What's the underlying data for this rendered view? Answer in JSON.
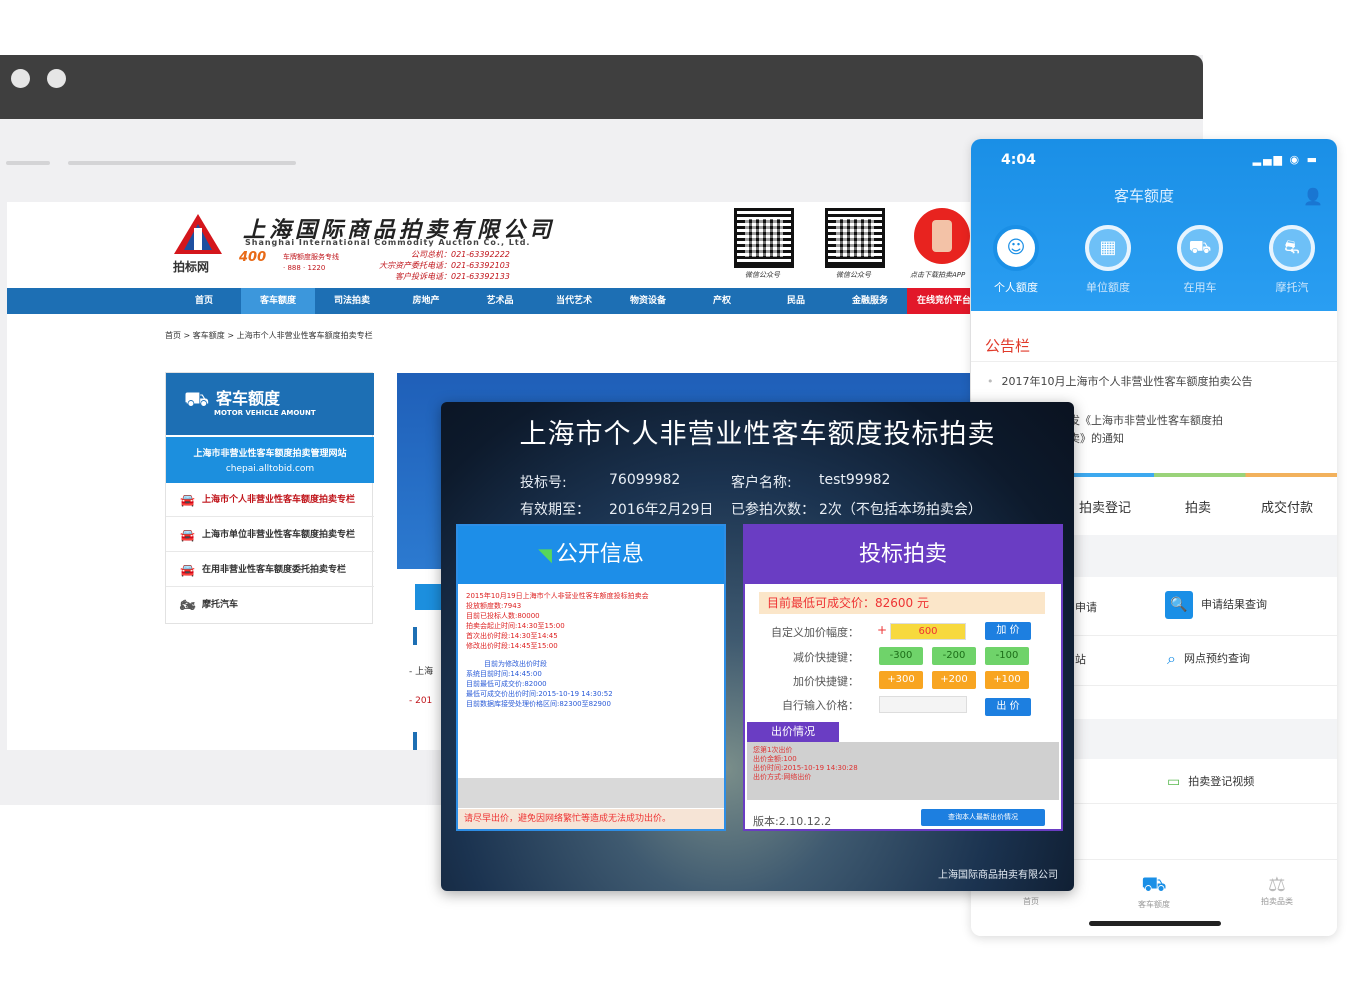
{
  "website": {
    "logo_small": "拍标网",
    "brand_cn": "上海国际商品拍卖有限公司",
    "brand_en": "Shanghai International Commodity Auction Co., Ltd.",
    "badge": "400",
    "hotline": "车牌额度服务专线",
    "hotline_num": "· 888 · 1220",
    "phones": [
      "公司总机：021-63392222",
      "大宗资产委托电话：021-63392103",
      "客户投诉电话：021-63392133"
    ],
    "qr_captions": [
      "微信公众号",
      "微信公众号"
    ],
    "app_caption": "点击下载拍卖APP",
    "nav": [
      {
        "label": "首页",
        "state": "normal"
      },
      {
        "label": "客车额度",
        "state": "active"
      },
      {
        "label": "司法拍卖",
        "state": "normal"
      },
      {
        "label": "房地产",
        "state": "normal"
      },
      {
        "label": "艺术品",
        "state": "normal"
      },
      {
        "label": "当代艺术",
        "state": "normal"
      },
      {
        "label": "物资设备",
        "state": "normal"
      },
      {
        "label": "产权",
        "state": "normal"
      },
      {
        "label": "民品",
        "state": "normal"
      },
      {
        "label": "金融服务",
        "state": "normal"
      },
      {
        "label": "在线竞价平台",
        "state": "highlight"
      }
    ],
    "breadcrumb": "首页 > 客车额度 > 上海市个人非营业性客车额度拍卖专栏",
    "sidebar": {
      "title": "客车额度",
      "subtitle": "MOTOR VEHICLE AMOUNT",
      "highlight_line1": "上海市非营业性客车额度拍卖管理网站",
      "highlight_line2": "chepai.alltobid.com",
      "items": [
        {
          "label": "上海市个人非营业性客车额度拍卖专栏",
          "icon": "car-icon"
        },
        {
          "label": "上海市单位非营业性客车额度拍卖专栏",
          "icon": "car-icon"
        },
        {
          "label": "在用非营业性客车额度委托拍卖专栏",
          "icon": "car-icon"
        },
        {
          "label": "摩托汽车",
          "icon": "motorcycle-icon"
        }
      ]
    },
    "content_snippets": [
      "- 上海",
      "- 201"
    ]
  },
  "auction": {
    "title": "上海市个人非营业性客车额度投标拍卖",
    "bid_no_label": "投标号:",
    "bid_no": "76099982",
    "customer_label": "客户名称:",
    "customer": "test99982",
    "valid_label": "有效期至：",
    "valid": "2016年2月29日",
    "count_label": "已参拍次数：",
    "count": "2次（不包括本场拍卖会）",
    "public_info": {
      "title": "公开信息",
      "lines_red": [
        "2015年10月19日上海市个人非营业性客车额度投标拍卖会",
        "投放额度数:7943",
        "目前已投标人数:80000",
        "拍卖会起止时间:14:30至15:00",
        "首次出价时段:14:30至14:45",
        "修改出价时段:14:45至15:00"
      ],
      "lines_blue": [
        "目前为修改出价时段",
        "系统目前时间:14:45:00",
        "目前最低可成交价:82000"
      ],
      "lines_mix": [
        "最低可成交价出价时间:2015-10-19 14:30:52",
        "目前数据库接受处理价格区间:82300至82900"
      ],
      "warning": "请尽早出价，避免因网络繁忙等造成无法成功出价。"
    },
    "bidding": {
      "title": "投标拍卖",
      "lowest_price": "目前最低可成交价：82600 元",
      "custom_label": "自定义加价幅度：",
      "custom_value": "600",
      "add_button": "加 价",
      "minus_label": "减价快捷键：",
      "minus_buttons": [
        "-300",
        "-200",
        "-100"
      ],
      "plus_label": "加价快捷键：",
      "plus_buttons": [
        "+300",
        "+200",
        "+100"
      ],
      "input_label": "自行输入价格：",
      "input_value": "",
      "bid_button": "出 价",
      "tab_label": "出价情况",
      "log": [
        "您第1次出价",
        "出价金额:100",
        "出价时间:2015-10-19 14:30:28",
        "出价方式:网络出价"
      ],
      "version": "版本:2.10.12.2",
      "query_button": "查询本人最新出价情况"
    },
    "footer": "上海国际商品拍卖有限公司"
  },
  "mobile": {
    "time": "4:04",
    "status": "▂▄▆ ◉ ▬",
    "title": "客车额度",
    "tabs": [
      {
        "label": "个人额度",
        "icon": "person-icon",
        "active": true
      },
      {
        "label": "单位额度",
        "icon": "building-icon",
        "active": false
      },
      {
        "label": "在用车",
        "icon": "car-icon",
        "active": false
      },
      {
        "label": "摩托汽",
        "icon": "motorcycle-icon",
        "active": false
      }
    ],
    "notice_title": "公告栏",
    "notices": [
      "2017年10月上海市个人非营业性客车额度拍卖公告",
      "市政府关于印发《上海市非营业性客车额度拍",
      "卖》的通知"
    ],
    "steps": [
      "拍卖登记",
      "拍卖",
      "成交付款"
    ],
    "rows": [
      {
        "left": "申请",
        "right": "申请结果查询"
      },
      {
        "left": "站",
        "right": "网点预约查询"
      },
      {
        "left": "",
        "right": "拍卖登记视频"
      }
    ],
    "bottom": [
      {
        "label": "首页",
        "icon": "home-icon",
        "active": false
      },
      {
        "label": "客车额度",
        "icon": "car-icon",
        "active": true
      },
      {
        "label": "拍卖品类",
        "icon": "auction-icon",
        "active": false
      }
    ]
  },
  "colors": {
    "site_blue": "#1d6fb4",
    "phone_blue": "#1a8fe6",
    "auction_purple": "#6a3dc3",
    "alert_red": "#e2182a"
  }
}
